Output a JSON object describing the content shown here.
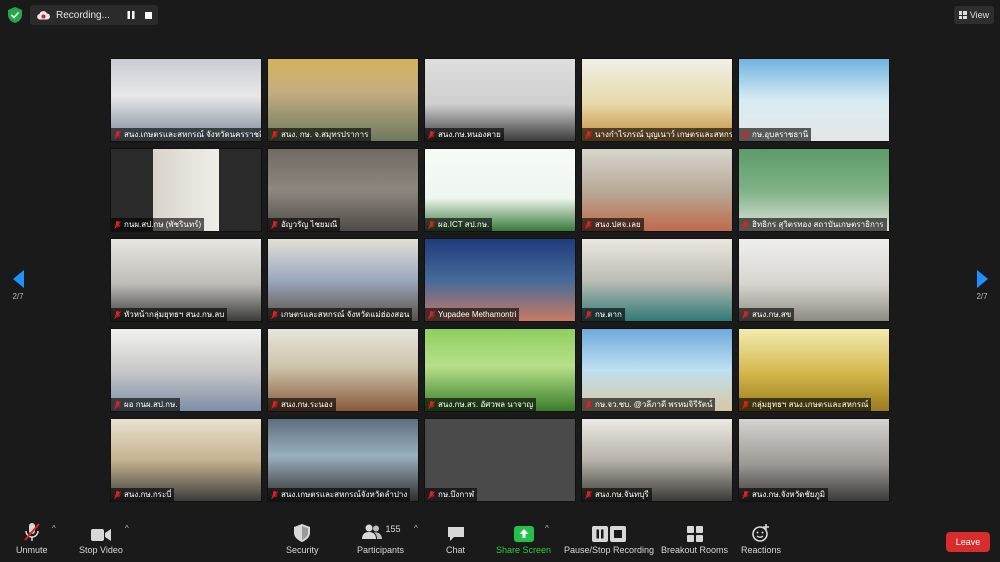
{
  "top_bar": {
    "recording_label": "Recording...",
    "view_label": "View"
  },
  "paging": {
    "left_indicator": "2/7",
    "right_indicator": "2/7"
  },
  "participants": [
    {
      "name": "สนง.เกษตรและสหกรณ์ จังหวัดนครราชสีมา"
    },
    {
      "name": "สนง. กษ. จ.สมุทรปราการ"
    },
    {
      "name": "สนง.กษ.หนองคาย"
    },
    {
      "name": "นางกำไรภรณ์ บุญเนาว์ เกษตรและสหกรณ์"
    },
    {
      "name": "กษ.อุบลราชธานี"
    },
    {
      "name": "กนผ.สป.กษ (พัชรินทร์)"
    },
    {
      "name": "อัญวรัญ ไชยมณี"
    },
    {
      "name": "ผอ.ICT สป.กษ."
    },
    {
      "name": "สนง.ปสจ.เลย"
    },
    {
      "name": "ฮิทธิกร สุวิตรทอง สถาบันเกษตราธิการ"
    },
    {
      "name": "หัวหน้ากลุ่มยุทธฯ สนง.กษ.ลบ"
    },
    {
      "name": "เกษตรและสหกรณ์ จังหวัดแม่ฮ่องสอน"
    },
    {
      "name": "Yupadee Methamontri"
    },
    {
      "name": "กษ.ตาก"
    },
    {
      "name": "สนง.กษ.สข"
    },
    {
      "name": "ผอ กนผ.สป.กษ."
    },
    {
      "name": "สนง.กษ.ระนอง"
    },
    {
      "name": "สนง.กษ.สร. อัศวพล นาจาญ"
    },
    {
      "name": "กษ.จว.ชบ. @วลีภาดี พรหมจิรีรัตน์"
    },
    {
      "name": "กลุ่มยุทธฯ สนง.เกษตรและสหกรณ์"
    },
    {
      "name": "สนง.กษ.กระบี่"
    },
    {
      "name": "สนง.เกษตรและสหกรณ์จังหวัดลำปาง"
    },
    {
      "name": "กษ.บึงกาฬ"
    },
    {
      "name": "สนง.กษ.จันทบุรี"
    },
    {
      "name": "สนง.กษ.จังหวัดชัยภูมิ"
    }
  ],
  "toolbar": {
    "unmute": "Unmute",
    "stop_video": "Stop Video",
    "security": "Security",
    "participants": "Participants",
    "participants_count": "155",
    "chat": "Chat",
    "share_screen": "Share Screen",
    "pause_stop_recording": "Pause/Stop Recording",
    "breakout_rooms": "Breakout Rooms",
    "reactions": "Reactions",
    "leave": "Leave"
  }
}
